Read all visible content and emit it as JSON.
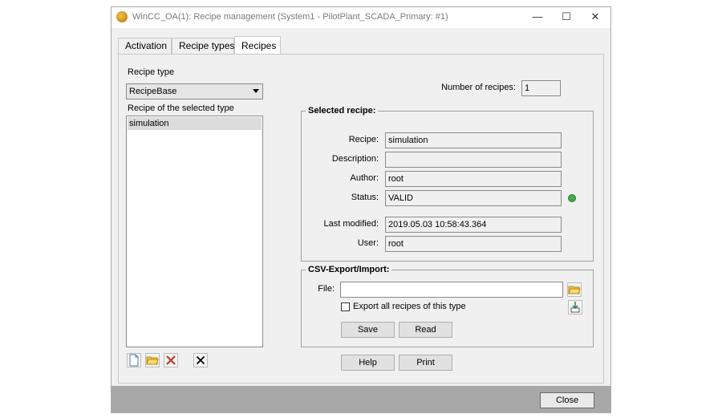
{
  "window": {
    "title": "WinCC_OA(1): Recipe management (System1 - PilotPlant_SCADA_Primary: #1)",
    "minimize": "—",
    "maximize": "☐",
    "close": "✕"
  },
  "tabs": [
    {
      "label": "Activation"
    },
    {
      "label": "Recipe types"
    },
    {
      "label": "Recipes",
      "active": true
    }
  ],
  "left": {
    "recipe_type_label": "Recipe type",
    "recipe_type_value": "RecipeBase",
    "recipe_list_label": "Recipe of the selected type",
    "recipes": [
      "simulation"
    ],
    "toolbar_icons": [
      "new-document-icon",
      "open-folder-icon",
      "delete-icon",
      "close-icon"
    ]
  },
  "number_of_recipes": {
    "label": "Number of recipes:",
    "value": "1"
  },
  "selected_recipe": {
    "title": "Selected recipe:",
    "recipe_label": "Recipe:",
    "recipe_value": "simulation",
    "description_label": "Description:",
    "description_value": "",
    "author_label": "Author:",
    "author_value": "root",
    "status_label": "Status:",
    "status_value": "VALID",
    "status_color": "#3cb043",
    "last_modified_label": "Last modified:",
    "last_modified_value": "2019.05.03 10:58:43.364",
    "user_label": "User:",
    "user_value": "root"
  },
  "csv": {
    "title": "CSV-Export/Import:",
    "file_label": "File:",
    "file_value": "",
    "export_all_label": "Export all recipes of this type",
    "export_all_checked": false,
    "save_label": "Save",
    "read_label": "Read"
  },
  "bottom": {
    "help_label": "Help",
    "print_label": "Print",
    "close_label": "Close"
  }
}
